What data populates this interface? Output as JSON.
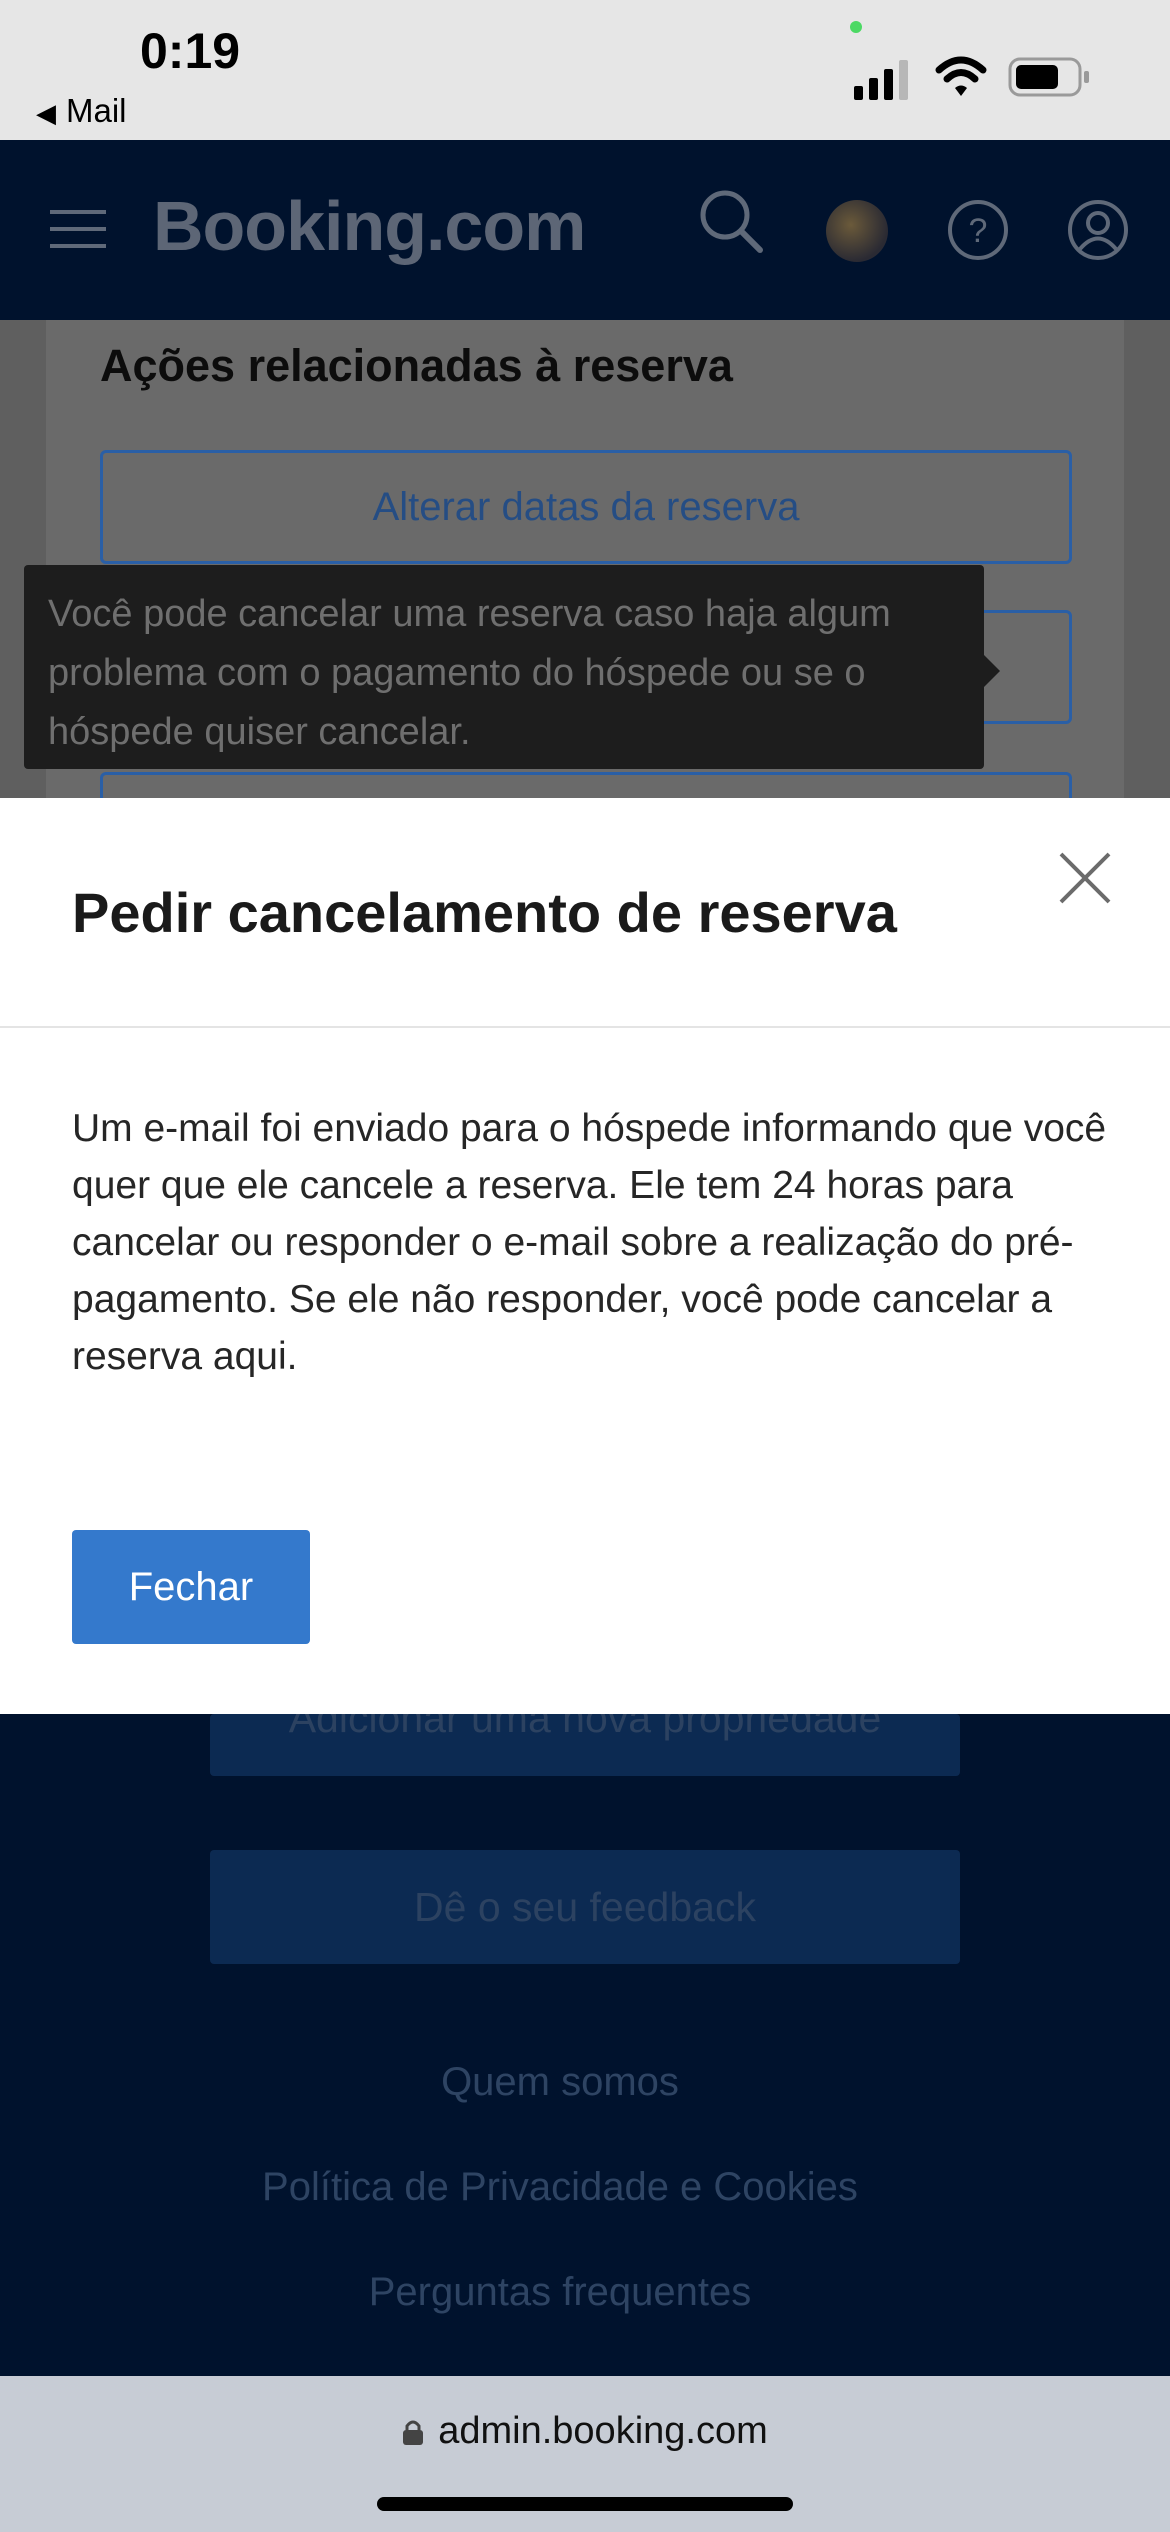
{
  "status_bar": {
    "time": "0:19",
    "back_label": "Mail"
  },
  "header": {
    "logo": "Booking.com",
    "icons": [
      "menu-icon",
      "search-icon",
      "avatar",
      "help-icon",
      "account-icon"
    ]
  },
  "page": {
    "section_title": "Ações relacionadas à reserva",
    "alter_dates_button": "Alterar datas da reserva",
    "tooltip": "Você pode cancelar uma reserva caso haja algum problema com o pagamento do hóspede ou se o hóspede quiser cancelar."
  },
  "modal": {
    "title": "Pedir cancelamento de reserva",
    "body": "Um e-mail foi enviado para o hóspede informando que você quer que ele cancele a reserva. Ele tem 24 horas para cancelar ou responder o e-mail sobre a realização do pré-pagamento. Se ele não responder, você pode cancelar a reserva aqui.",
    "close_button": "Fechar"
  },
  "footer": {
    "add_property_button": "Adicionar uma nova propriedade",
    "feedback_button": "Dê o seu feedback",
    "links": [
      "Quem somos",
      "Política de Privacidade e Cookies",
      "Perguntas frequentes"
    ]
  },
  "browser": {
    "url": "admin.booking.com"
  },
  "colors": {
    "primary_blue": "#3479cc",
    "header_navy": "#00122d"
  }
}
